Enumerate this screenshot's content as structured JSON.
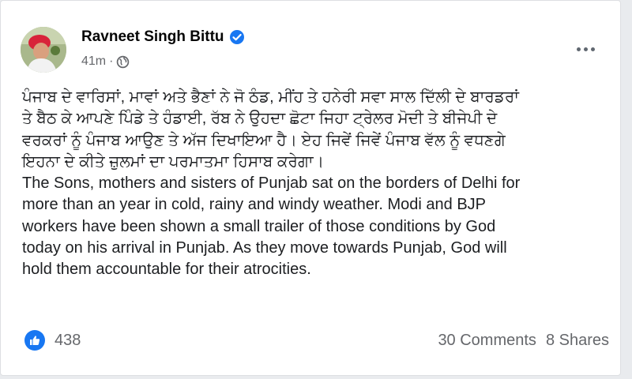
{
  "post": {
    "author": "Ravneet Singh Bittu",
    "time": "41m",
    "separator": "·",
    "audience_icon": "globe-icon",
    "verified_icon": "verified-badge-icon",
    "more_icon": "more-options-icon",
    "text_punjabi": "ਪੰਜਾਬ ਦੇ ਵਾਰਿਸਾਂ, ਮਾਵਾਂ ਅਤੇ ਭੈਣਾਂ ਨੇ ਜੋ ਠੰਡ, ਮੀਂਹ ਤੇ ਹਨੇਰੀ ਸਵਾ ਸਾਲ ਦਿੱਲੀ ਦੇ ਬਾਰਡਰਾਂ\nਤੇ ਬੈਠ ਕੇ ਆਪਣੇ ਪਿੰਡੇ ਤੇ ਹੰਡਾਈ, ਰੱਬ ਨੇ ਉਹਦਾ ਛੋਟਾ ਜਿਹਾ ਟ੍ਰੇਲਰ ਮੋਦੀ ਤੇ ਬੀਜੇਪੀ ਦੇ\nਵਰਕਰਾਂ ਨੂੰ ਪੰਜਾਬ ਆਉਣ ਤੇ ਅੱਜ ਦਿਖਾਇਆ ਹੈ। ਏਹ ਜਿਵੇਂ ਜਿਵੇਂ ਪੰਜਾਬ ਵੱਲ ਨੂੰ ਵਧਣਗੇ\nਇਹਨਾ ਦੇ ਕੀਤੇ ਜ਼ੁਲਮਾਂ ਦਾ ਪਰਮਾਤਮਾ ਹਿਸਾਬ ਕਰੇਗਾ।",
    "text_english": "The Sons, mothers and sisters of Punjab sat on the borders of Delhi for\nmore than an year in cold, rainy and windy weather. Modi and BJP\nworkers have been shown a small trailer of those conditions by God\ntoday on his arrival in Punjab. As they move towards Punjab, God will\nhold them accountable for their atrocities."
  },
  "footer": {
    "like_icon": "like-reaction-icon",
    "likes": "438",
    "comments": "30 Comments",
    "shares": "8 Shares"
  },
  "colors": {
    "accent": "#1877f2",
    "secondary_text": "#65676b",
    "primary_text": "#050505"
  }
}
